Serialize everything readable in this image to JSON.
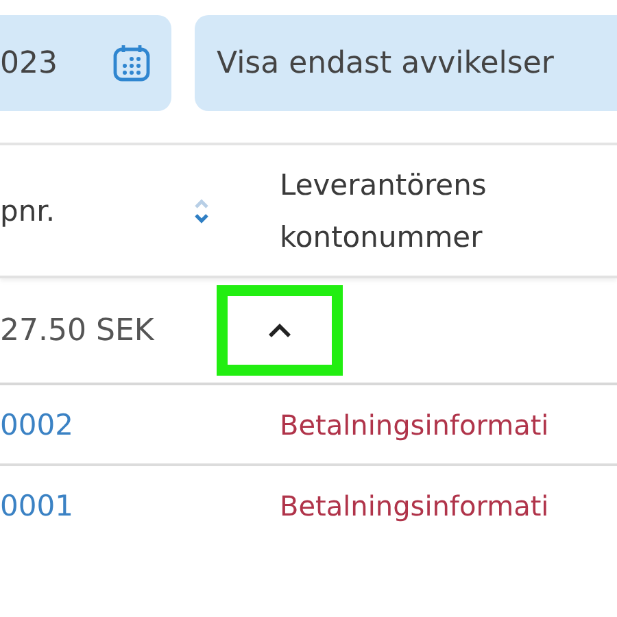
{
  "filters": {
    "date_value": "023",
    "toggle_label": "Visa endast avvikelser"
  },
  "table": {
    "columns": [
      {
        "label": "pnr.",
        "sortable": true
      },
      {
        "label": "Leverantörens kontonummer",
        "sortable": false
      }
    ],
    "group": {
      "amount": "27.50 SEK",
      "expanded": true,
      "highlighted": true
    },
    "rows": [
      {
        "column_1": "0002",
        "column_2": "Betalningsinformati"
      },
      {
        "column_1": "0001",
        "column_2": "Betalningsinformati"
      }
    ]
  }
}
